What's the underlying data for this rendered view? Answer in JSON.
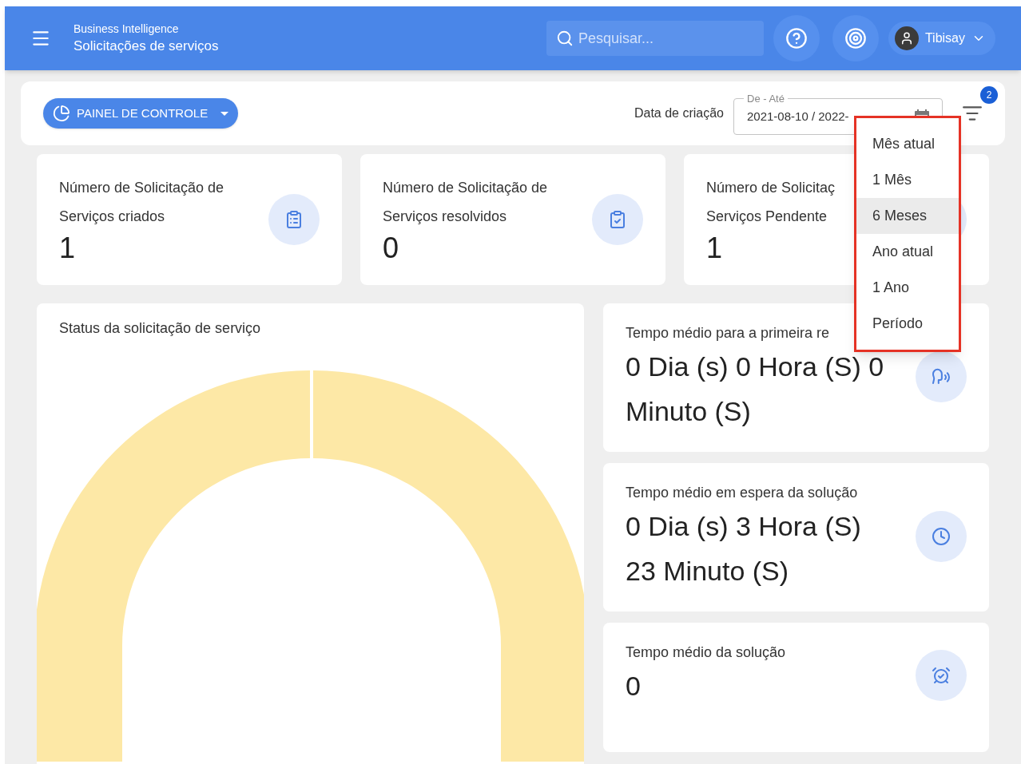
{
  "header": {
    "app_name": "Business Intelligence",
    "page_title": "Solicitações de serviços",
    "search": {
      "placeholder": "Pesquisar..."
    },
    "user": {
      "name": "Tibisay"
    }
  },
  "toolbar": {
    "dashboard_button": "PAINEL DE CONTROLE",
    "date_filter": {
      "label": "Data de criação",
      "field_label": "De - Até",
      "value": "2021-08-10 / 2022-"
    },
    "filter_badge": "2"
  },
  "stat_cards": [
    {
      "title_lines": [
        "Número de Solicitação de",
        "Serviços criados"
      ],
      "value": "1"
    },
    {
      "title_lines": [
        "Número de Solicitação de",
        "Serviços resolvidos"
      ],
      "value": "0"
    },
    {
      "title_lines": [
        "Número de Solicitaç",
        "Serviços Pendente"
      ],
      "value": "1"
    }
  ],
  "status_card": {
    "title": "Status da solicitação de serviço"
  },
  "time_cards": [
    {
      "title": "Tempo médio para a primeira re",
      "value": "0 Dia (s) 0 Hora (S) 0 Minuto (S)"
    },
    {
      "title": "Tempo médio em espera da solução",
      "value": "0 Dia (s) 3 Hora (S) 23 Minuto (S)"
    },
    {
      "title": "Tempo médio da solução",
      "value": "0"
    }
  ],
  "period_menu": {
    "items": [
      {
        "label": "Mês atual",
        "selected": false
      },
      {
        "label": "1 Mês",
        "selected": false
      },
      {
        "label": "6 Meses",
        "selected": true
      },
      {
        "label": "Ano atual",
        "selected": false
      },
      {
        "label": "1 Ano",
        "selected": false
      },
      {
        "label": "Período",
        "selected": false
      }
    ]
  }
}
